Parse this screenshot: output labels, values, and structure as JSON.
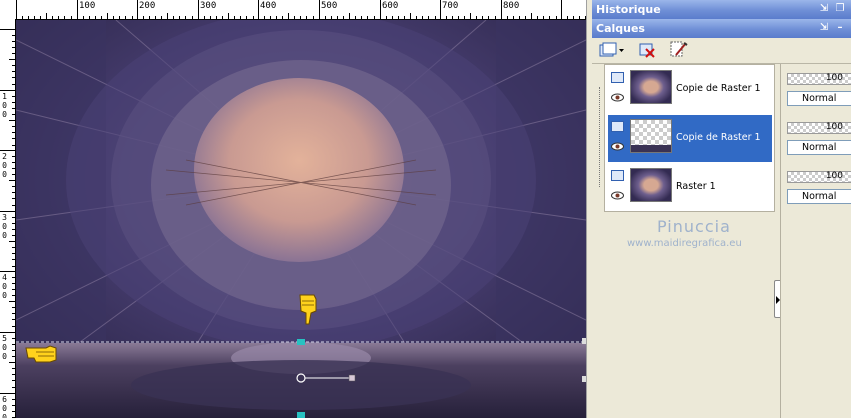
{
  "rulers": {
    "horizontal": [
      "100",
      "200",
      "300",
      "400",
      "500",
      "600",
      "700",
      "800"
    ],
    "vertical": [
      "1\n0\n0",
      "2\n0\n0",
      "3\n0\n0",
      "4\n0\n0",
      "5\n0\n0",
      "6\n0\n0"
    ]
  },
  "panels": {
    "history": {
      "title": "Historique"
    },
    "layers": {
      "title": "Calques"
    }
  },
  "layers": [
    {
      "name": "Copie de Raster 1",
      "opacity": "100",
      "blend_mode": "Normal",
      "selected": false
    },
    {
      "name": "Copie de Raster 1",
      "opacity": "100",
      "blend_mode": "Normal",
      "selected": true
    },
    {
      "name": "Raster 1",
      "opacity": "100",
      "blend_mode": "Normal",
      "selected": false
    }
  ],
  "watermark": {
    "name": "Pinuccia",
    "url": "www.maidiregrafica.eu"
  },
  "colors": {
    "panel_title_start": "#9bb6ea",
    "panel_title_end": "#5a7ccc",
    "selection": "#316ac5",
    "panel_bg": "#ece9d8"
  },
  "icons": [
    "new-layer-icon",
    "delete-layer-icon",
    "edit-mask-icon",
    "eye-icon",
    "pointing-hand-icon"
  ]
}
